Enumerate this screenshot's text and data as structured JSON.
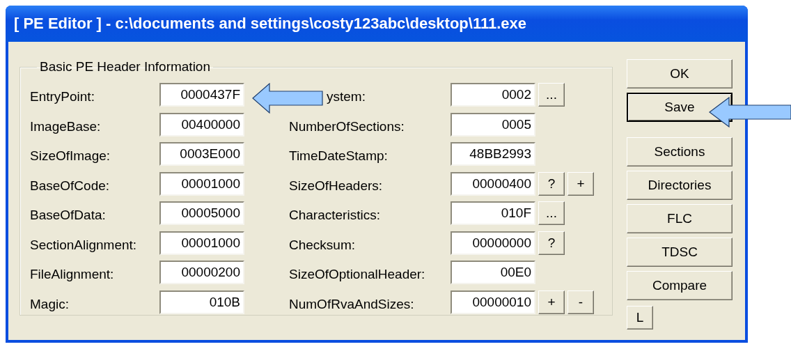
{
  "window": {
    "title": "[ PE Editor ] - c:\\documents and settings\\costy123abc\\desktop\\111.exe"
  },
  "group": {
    "title": "Basic PE Header Information"
  },
  "left_fields": [
    {
      "label": "EntryPoint:",
      "value": "0000437F"
    },
    {
      "label": "ImageBase:",
      "value": "00400000"
    },
    {
      "label": "SizeOfImage:",
      "value": "0003E000"
    },
    {
      "label": "BaseOfCode:",
      "value": "00001000"
    },
    {
      "label": "BaseOfData:",
      "value": "00005000"
    },
    {
      "label": "SectionAlignment:",
      "value": "00001000"
    },
    {
      "label": "FileAlignment:",
      "value": "00000200"
    },
    {
      "label": "Magic:",
      "value": "010B"
    }
  ],
  "right_fields": [
    {
      "label": "ystem:",
      "value": "0002",
      "buttons": [
        "..."
      ]
    },
    {
      "label": "NumberOfSections:",
      "value": "0005"
    },
    {
      "label": "TimeDateStamp:",
      "value": "48BB2993"
    },
    {
      "label": "SizeOfHeaders:",
      "value": "00000400",
      "buttons": [
        "?",
        "+"
      ]
    },
    {
      "label": "Characteristics:",
      "value": "010F",
      "buttons": [
        "..."
      ]
    },
    {
      "label": "Checksum:",
      "value": "00000000",
      "buttons": [
        "?"
      ]
    },
    {
      "label": "SizeOfOptionalHeader:",
      "value": "00E0"
    },
    {
      "label": "NumOfRvaAndSizes:",
      "value": "00000010",
      "buttons": [
        "+",
        "-"
      ]
    }
  ],
  "side_buttons": [
    [
      {
        "label": "OK",
        "focused": false
      },
      {
        "label": "Save",
        "focused": true
      }
    ],
    [
      {
        "label": "Sections",
        "focused": false
      },
      {
        "label": "Directories",
        "focused": false
      },
      {
        "label": "FLC",
        "focused": false
      },
      {
        "label": "TDSC",
        "focused": false
      },
      {
        "label": "Compare",
        "focused": false
      }
    ]
  ],
  "small_button": "L"
}
